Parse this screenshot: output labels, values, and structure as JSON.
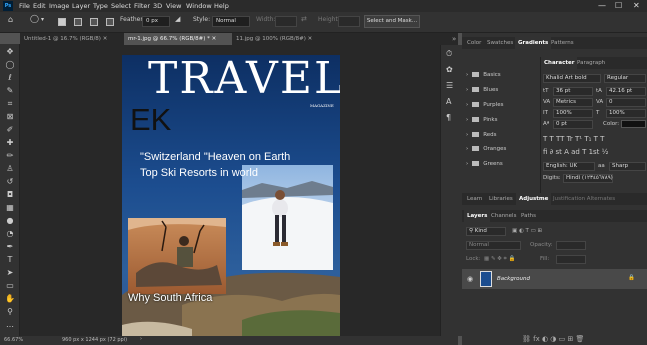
{
  "menu": {
    "logo": "Ps",
    "items": [
      "File",
      "Edit",
      "Image",
      "Layer",
      "Type",
      "Select",
      "Filter",
      "3D",
      "View",
      "Window",
      "Help"
    ],
    "window_controls": [
      "—",
      "☐",
      "✕"
    ]
  },
  "options": {
    "feather_label": "Feather:",
    "feather_value": "0 px",
    "style_label": "Style:",
    "style_value": "Normal",
    "width_label": "Width:",
    "height_label": "Height:",
    "select_mask": "Select and Mask..."
  },
  "doc_tabs": [
    "Untitled-1 @ 16.7% (RGB/8)",
    "mr-1.jpg @ 66.7% (RGB/8#) *",
    "11.jpg @ 100% (RGB/8#)"
  ],
  "magazine": {
    "title": "TRAVEL",
    "subtitle": "MAGAZINE",
    "initials": "EK",
    "headline1": "\"Switzerland \"Heaven on Earth",
    "headline2": "Top Ski Resorts in world",
    "bottom_caption": "Why South Africa"
  },
  "status": {
    "zoom": "66.67%",
    "doc_size": "960 px x 1244 px (72 ppi)"
  },
  "swatches": {
    "tabs": [
      "Color",
      "Swatches",
      "Gradients",
      "Patterns"
    ],
    "active": "Gradients",
    "groups": [
      "Basics",
      "Blues",
      "Purples",
      "Pinks",
      "Reds",
      "Oranges",
      "Greens"
    ]
  },
  "character": {
    "tabs": [
      "Character",
      "Paragraph"
    ],
    "font": "Khalid Art bold",
    "style": "Regular",
    "size": "36 pt",
    "leading": "42.16 pt",
    "kerning": "Metrics",
    "tracking": "0",
    "vscale": "100%",
    "hscale": "100%",
    "baseline": "0 pt",
    "color_label": "Color:",
    "language": "English: UK",
    "aa": "Sharp",
    "digits_label": "Digits:",
    "digits": "Hindi (١٢٣٤٥٦٧٨٩)"
  },
  "midtabs": [
    "Learn",
    "Libraries",
    "Adjustme",
    "Justification Alternates"
  ],
  "layers": {
    "tabs": [
      "Layers",
      "Channels",
      "Paths"
    ],
    "kind": "Kind",
    "blend": "Normal",
    "opacity_label": "Opacity:",
    "lock_label": "Lock:",
    "fill_label": "Fill:",
    "layer_name": "Background"
  },
  "colors": {
    "accent": "#31a8ff",
    "panel": "#323232",
    "app_bg": "#535353"
  }
}
